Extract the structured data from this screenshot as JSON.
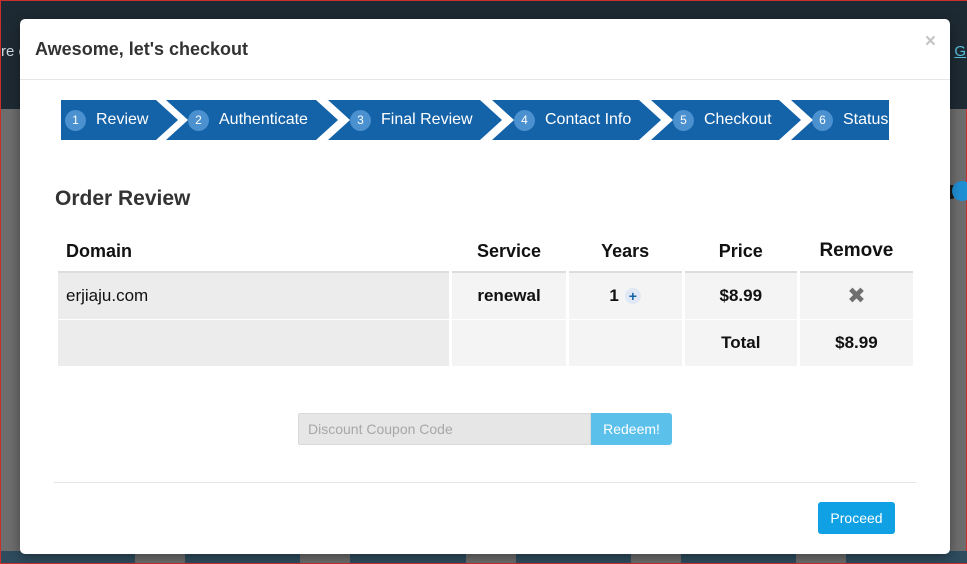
{
  "backdrop": {
    "left_peek_text": "re e",
    "right_peek_text": "G"
  },
  "modal": {
    "title": "Awesome, let's checkout",
    "close_glyph": "×"
  },
  "steps": [
    {
      "num": "1",
      "label": "Review"
    },
    {
      "num": "2",
      "label": "Authenticate"
    },
    {
      "num": "3",
      "label": "Final Review"
    },
    {
      "num": "4",
      "label": "Contact Info"
    },
    {
      "num": "5",
      "label": "Checkout"
    },
    {
      "num": "6",
      "label": "Status"
    }
  ],
  "order": {
    "title": "Order Review",
    "columns": [
      "Domain",
      "Service",
      "Years",
      "Price",
      "Remove"
    ],
    "items": [
      {
        "domain": "erjiaju.com",
        "service": "renewal",
        "years": "1",
        "price": "$8.99"
      }
    ],
    "total_label": "Total",
    "total_value": "$8.99"
  },
  "icons": {
    "plus": "plus-icon",
    "remove": "remove-x-icon",
    "close": "close-icon"
  },
  "coupon": {
    "placeholder": "Discount Coupon Code",
    "redeem_label": "Redeem!"
  },
  "footer": {
    "proceed_label": "Proceed"
  },
  "colors": {
    "step_bg": "#1462a7",
    "redeem_bg": "#5bc0ea",
    "proceed_bg": "#10a1e4"
  }
}
